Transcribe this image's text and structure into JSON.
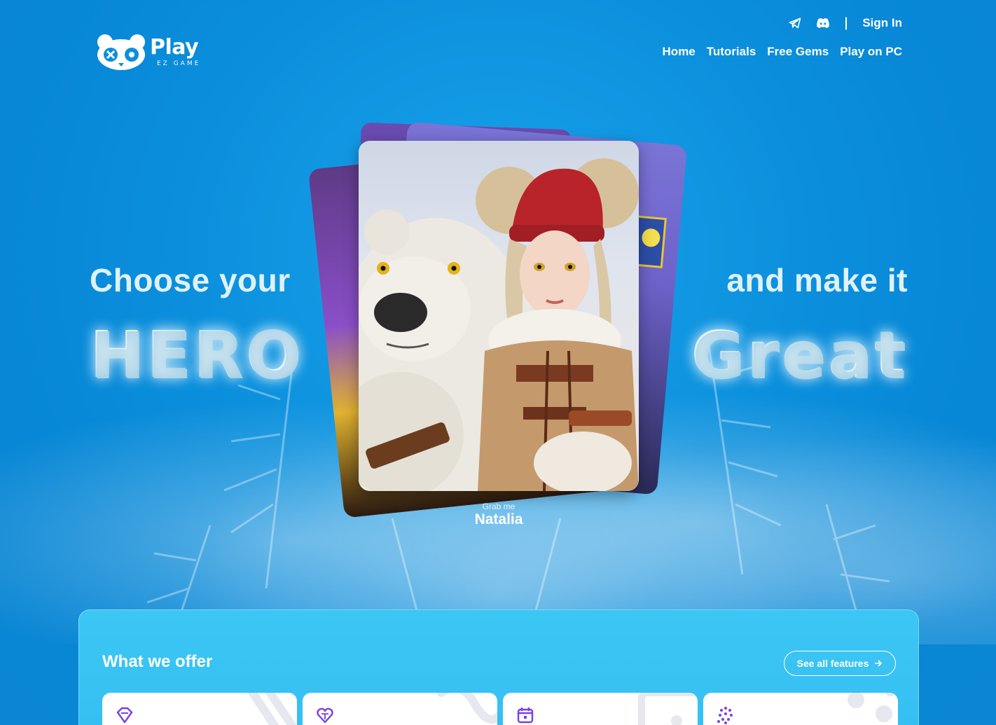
{
  "brand": {
    "name": "Play",
    "tagline": "EZ GAME"
  },
  "header": {
    "utility": {
      "telegram_icon": "telegram-icon",
      "discord_icon": "discord-icon",
      "separator": "|",
      "sign_in": "Sign In"
    },
    "nav": [
      "Home",
      "Tutorials",
      "Free Gems",
      "Play on PC"
    ]
  },
  "hero": {
    "left_line": "Choose your",
    "left_big": "HERO",
    "right_line": "and make it",
    "right_big": "Great",
    "card_caption_small": "Grab me",
    "card_caption_name": "Natalia"
  },
  "offer": {
    "title": "What we offer",
    "see_all": "See all features",
    "tiles": [
      {
        "icon": "gem-icon"
      },
      {
        "icon": "heart-gem-icon"
      },
      {
        "icon": "calendar-icon"
      },
      {
        "icon": "dots-icon"
      }
    ]
  },
  "colors": {
    "background": "#0b8fdc",
    "panel": "#3cc6f4",
    "accent_icon": "#7b3fe4"
  }
}
